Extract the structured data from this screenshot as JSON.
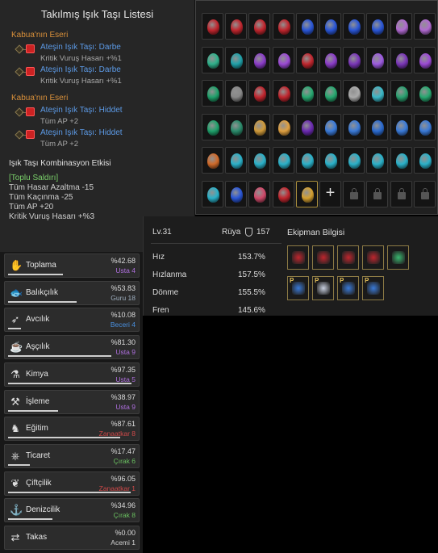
{
  "crystal_list": {
    "title": "Takılmış Işık Taşı Listesi",
    "groups": [
      {
        "title": "Kabua'nın Eseri",
        "items": [
          {
            "name": "Ateşin Işık Taşı: Darbe",
            "stat": "Kritik Vuruş Hasarı +%1"
          },
          {
            "name": "Ateşin Işık Taşı: Darbe",
            "stat": "Kritik Vuruş Hasarı +%1"
          }
        ]
      },
      {
        "title": "Kabua'nın Eseri",
        "items": [
          {
            "name": "Ateşin Işık Taşı: Hiddet",
            "stat": "Tüm AP +2"
          },
          {
            "name": "Ateşin Işık Taşı: Hiddet",
            "stat": "Tüm AP +2"
          }
        ]
      }
    ],
    "combo_title": "Işık Taşı Kombinasyon Etkisi",
    "combo_head": "[Toplu Saldırı]",
    "combo_lines": [
      "Tüm Hasar Azaltma -15",
      "Tüm Kaçınma -25",
      "Tüm AP +20",
      "Kritik Vuruş Hasarı +%3"
    ]
  },
  "grid": {
    "rows": [
      [
        "#c0262e",
        "#c0262e",
        "#c0262e",
        "#c0262e",
        "#2a56d6",
        "#2a56d6",
        "#2a56d6",
        "#2a56d6",
        "#b06ad0",
        "#b06ad0"
      ],
      [
        "#2fb08a",
        "#1fa0a8",
        "#8a3cc8",
        "#9b49d4",
        "#c0262e",
        "#8a3cc8",
        "#7a36b8",
        "#9c5ae0",
        "#7a36b8",
        "#9b49d4"
      ],
      [
        "#1fa06a",
        "#888888",
        "#c0262e",
        "#c0262e",
        "#27a870",
        "#27a870",
        "#aaaaaa",
        "#3ab8c8",
        "#2aa070",
        "#27a870"
      ],
      [
        "#1fa06a",
        "#2a8a6a",
        "#d09a3a",
        "#e0a040",
        "#6a2ab0",
        "#3a7ad8",
        "#3a7ad8",
        "#2a6ad0",
        "#3a7ad8",
        "#3a7ad8"
      ],
      [
        "#d06a2a",
        "#2ab0c8",
        "#2ab0c8",
        "#2ab0c8",
        "#2ab0c8",
        "#2ab0c8",
        "#2ab0c8",
        "#2ab0c8",
        "#2ab0c8",
        "#2ab0c8"
      ]
    ],
    "last_row": [
      "#2ab0c8",
      "#2a56d6",
      "#d04a6a",
      "#c0262e",
      "#d4a030"
    ],
    "plus_symbol": "+"
  },
  "stats": {
    "level": "Lv.31",
    "ruya_label": "Rüya",
    "ruya_value": "157",
    "rows": [
      {
        "label": "Hız",
        "value": "153.7%"
      },
      {
        "label": "Hızlanma",
        "value": "157.5%"
      },
      {
        "label": "Dönme",
        "value": "155.5%"
      },
      {
        "label": "Fren",
        "value": "145.6%"
      }
    ],
    "equipment_title": "Ekipman Bilgisi",
    "equipment_row1": [
      "#c0262e",
      "#c0262e",
      "#c0262e",
      "#c0262e",
      "#3ab870"
    ],
    "equipment_row2": [
      "#3a7ad8",
      "#c8d0e0",
      "#3a7ad8",
      "#3a7ad8"
    ],
    "equipment_flag": "P"
  },
  "skills": [
    {
      "name": "Toplama",
      "pct": "%42.68",
      "level": "Usta 4",
      "level_color": "#b070e0",
      "icon": "✋",
      "progress": 0.43
    },
    {
      "name": "Balıkçılık",
      "pct": "%53.83",
      "level": "Guru 18",
      "level_color": "#9fb0c0",
      "icon": "🐟",
      "progress": 0.54
    },
    {
      "name": "Avcılık",
      "pct": "%10.08",
      "level": "Beceri 4",
      "level_color": "#4a90e0",
      "icon": "➶",
      "progress": 0.1
    },
    {
      "name": "Aşçılık",
      "pct": "%81.30",
      "level": "Usta 9",
      "level_color": "#b070e0",
      "icon": "☕",
      "progress": 0.81
    },
    {
      "name": "Kimya",
      "pct": "%97.35",
      "level": "Usta 5",
      "level_color": "#b070e0",
      "icon": "⚗",
      "progress": 0.97
    },
    {
      "name": "İşleme",
      "pct": "%38.97",
      "level": "Usta 9",
      "level_color": "#b070e0",
      "icon": "⚒",
      "progress": 0.39
    },
    {
      "name": "Eğitim",
      "pct": "%87.61",
      "level": "Zanaatkar 8",
      "level_color": "#d04a4a",
      "icon": "♞",
      "progress": 0.88
    },
    {
      "name": "Ticaret",
      "pct": "%17.47",
      "level": "Çırak 6",
      "level_color": "#6ac060",
      "icon": "⎈",
      "progress": 0.17
    },
    {
      "name": "Çiftçilik",
      "pct": "%96.05",
      "level": "Zanaatkar 1",
      "level_color": "#d04a4a",
      "icon": "❦",
      "progress": 0.96
    },
    {
      "name": "Denizcilik",
      "pct": "%34.96",
      "level": "Çırak 8",
      "level_color": "#6ac060",
      "icon": "⚓",
      "progress": 0.35
    },
    {
      "name": "Takas",
      "pct": "%0.00",
      "level": "Acemi 1",
      "level_color": "#cfcfcf",
      "icon": "⇄",
      "progress": 0.0
    }
  ]
}
